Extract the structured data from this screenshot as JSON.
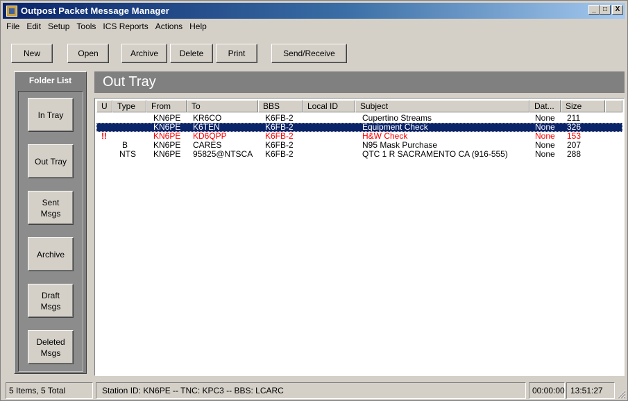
{
  "window": {
    "title": "Outpost Packet Message Manager",
    "controls": {
      "minimize": "_",
      "maximize": "□",
      "close": "X"
    }
  },
  "menu": [
    "File",
    "Edit",
    "Setup",
    "Tools",
    "ICS Reports",
    "Actions",
    "Help"
  ],
  "toolbar": {
    "new": "New",
    "open": "Open",
    "archive": "Archive",
    "delete": "Delete",
    "print": "Print",
    "send_receive": "Send/Receive"
  },
  "folders": {
    "header": "Folder List",
    "items": [
      "In Tray",
      "Out Tray",
      "Sent\nMsgs",
      "Archive",
      "Draft\nMsgs",
      "Deleted\nMsgs"
    ]
  },
  "main": {
    "title": "Out Tray",
    "columns": [
      "U",
      "Type",
      "From",
      "To",
      "BBS",
      "Local ID",
      "Subject",
      "Dat...",
      "Size"
    ],
    "rows": [
      {
        "u": "",
        "type": "",
        "from": "KN6PE",
        "to": "KR6CO",
        "bbs": "K6FB-2",
        "local_id": "",
        "subject": "Cupertino Streams",
        "date": "None",
        "size": "211",
        "state": "normal"
      },
      {
        "u": "",
        "type": "",
        "from": "KN6PE",
        "to": "K6TEN",
        "bbs": "K6FB-2",
        "local_id": "",
        "subject": "Equipment Check",
        "date": "None",
        "size": "326",
        "state": "selected"
      },
      {
        "u": "!!",
        "type": "",
        "from": "KN6PE",
        "to": "KD6QPP",
        "bbs": "K6FB-2",
        "local_id": "",
        "subject": "H&W Check",
        "date": "None",
        "size": "153",
        "state": "urgent"
      },
      {
        "u": "",
        "type": "B",
        "from": "KN6PE",
        "to": "CARES",
        "bbs": "K6FB-2",
        "local_id": "",
        "subject": "N95 Mask Purchase",
        "date": "None",
        "size": "207",
        "state": "normal"
      },
      {
        "u": "",
        "type": "NTS",
        "from": "KN6PE",
        "to": "95825@NTSCA",
        "bbs": "K6FB-2",
        "local_id": "",
        "subject": "QTC 1 R SACRAMENTO CA (916-555)",
        "date": "None",
        "size": "288",
        "state": "normal"
      }
    ]
  },
  "status": {
    "items": "5 Items, 5 Total",
    "station": "Station ID: KN6PE  --  TNC: KPC3  --  BBS: LCARC",
    "elapsed": "00:00:00",
    "clock": "13:51:27"
  }
}
